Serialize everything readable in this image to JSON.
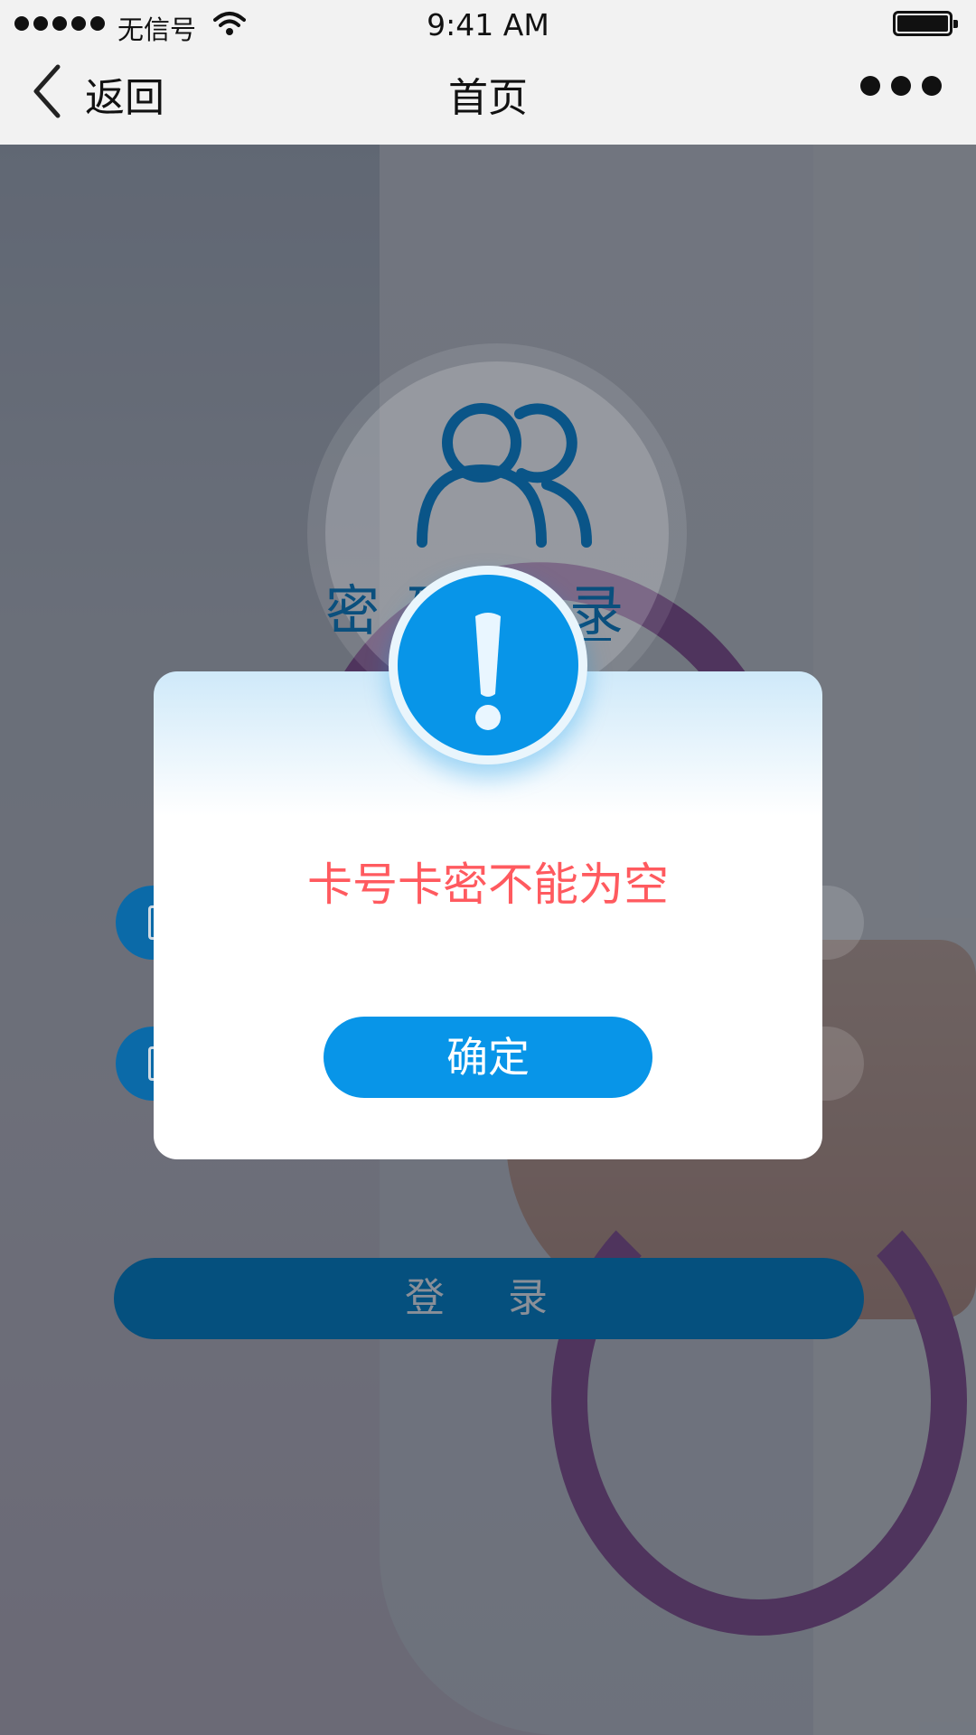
{
  "status_bar": {
    "carrier": "无信号",
    "time": "9:41 AM"
  },
  "nav": {
    "back_label": "返回",
    "title": "首页"
  },
  "login": {
    "heading": "密码登录",
    "button_label": "登 录"
  },
  "modal": {
    "message": "卡号卡密不能为空",
    "confirm_label": "确定"
  },
  "colors": {
    "primary": "#0895e8",
    "error_text": "#ff5a5f",
    "dark_blue": "#05507e"
  },
  "icons": [
    "back-chevron-icon",
    "more-icon",
    "user-group-icon",
    "alert-icon",
    "wifi-icon",
    "battery-icon"
  ]
}
